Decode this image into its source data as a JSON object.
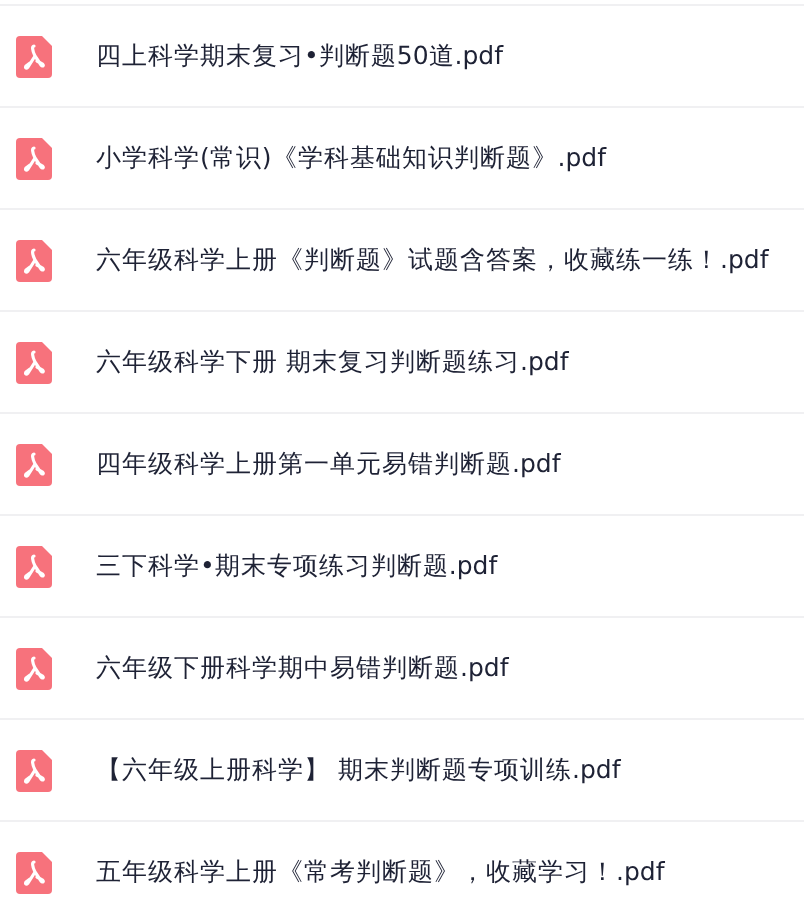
{
  "files": [
    {
      "name": "四上科学期末复习•判断题50道.pdf"
    },
    {
      "name": "小学科学(常识)《学科基础知识判断题》.pdf"
    },
    {
      "name": "六年级科学上册《判断题》试题含答案，收藏练一练！.pdf"
    },
    {
      "name": "六年级科学下册 期末复习判断题练习.pdf"
    },
    {
      "name": "四年级科学上册第一单元易错判断题.pdf"
    },
    {
      "name": "三下科学•期末专项练习判断题.pdf"
    },
    {
      "name": "六年级下册科学期中易错判断题.pdf"
    },
    {
      "name": "【六年级上册科学】 期末判断题专项训练.pdf"
    },
    {
      "name": "五年级科学上册《常考判断题》，收藏学习！.pdf"
    }
  ]
}
